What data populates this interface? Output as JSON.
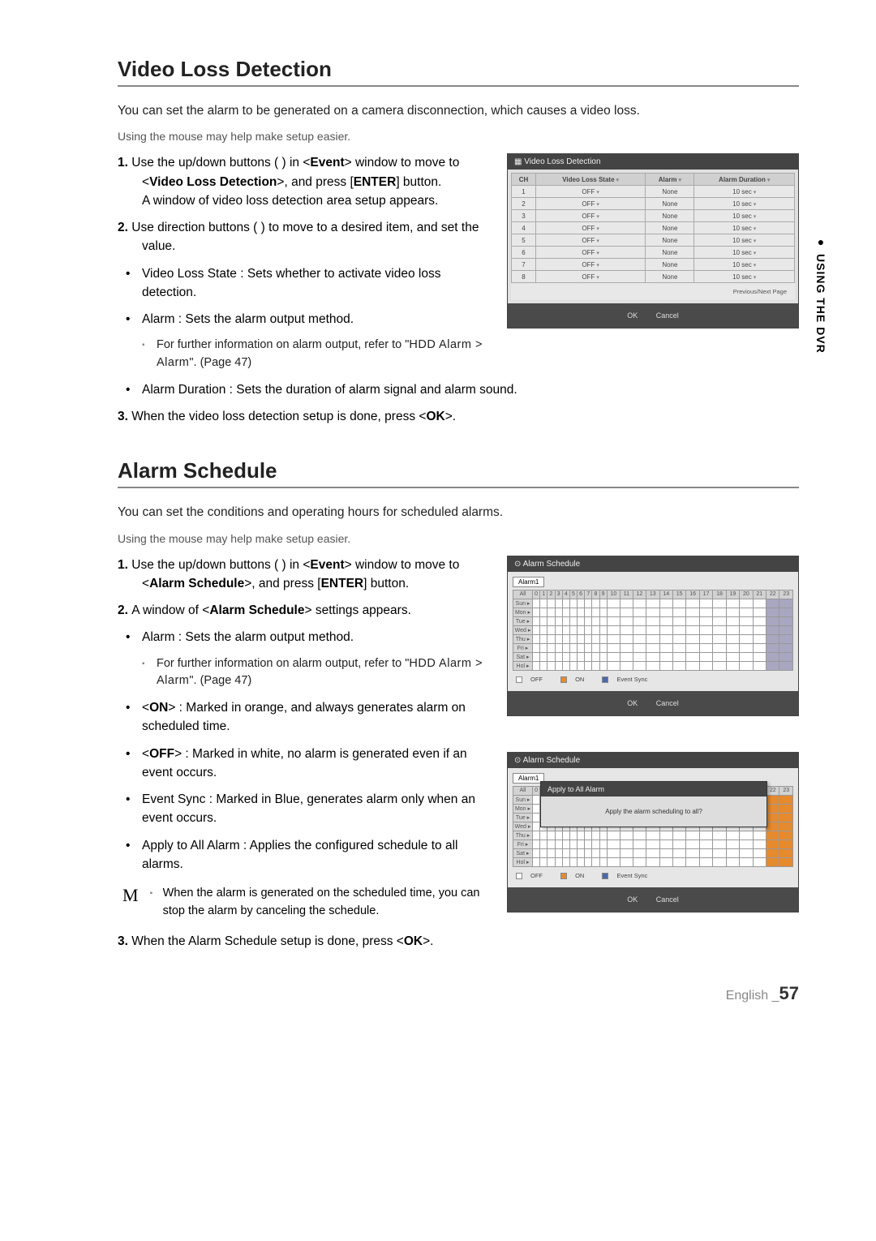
{
  "side_tab": "USING THE DVR",
  "section1": {
    "title": "Video Loss Detection",
    "intro": "You can set the alarm to be generated on a camera disconnection, which causes a video loss.",
    "mouse_hint": "Using the mouse may help make setup easier.",
    "step1_num": "1.",
    "step1_a": "Use the up/down buttons (     ) in <",
    "step1_event": "Event",
    "step1_b": "> window to move to <",
    "step1_vld": "Video Loss Detection",
    "step1_c": ">, and press [",
    "step1_enter": "ENTER",
    "step1_d": "] button.",
    "step1_e": "A window of video loss detection area setup appears.",
    "step2_num": "2.",
    "step2_a": "Use direction buttons (           ) to move to a desired item, and set the value.",
    "bul1": "Video Loss State : Sets whether to activate video loss detection.",
    "bul2": "Alarm : Sets the alarm output method.",
    "sub1_a": "For further information on alarm output, refer to \"",
    "sub1_hdd": "HDD Alarm > Alarm",
    "sub1_b": "\". (Page 47)",
    "bul3": "Alarm Duration : Sets the duration of alarm signal and alarm sound.",
    "step3_num": "3.",
    "step3_a": "When the video loss detection setup is done, press <",
    "step3_ok": "OK",
    "step3_b": ">."
  },
  "vld_panel": {
    "title": "Video Loss Detection",
    "headers": {
      "ch": "CH",
      "state": "Video Loss State",
      "alarm": "Alarm",
      "duration": "Alarm Duration"
    },
    "rows": [
      {
        "ch": "1",
        "state": "OFF",
        "alarm": "None",
        "duration": "10 sec"
      },
      {
        "ch": "2",
        "state": "OFF",
        "alarm": "None",
        "duration": "10 sec"
      },
      {
        "ch": "3",
        "state": "OFF",
        "alarm": "None",
        "duration": "10 sec"
      },
      {
        "ch": "4",
        "state": "OFF",
        "alarm": "None",
        "duration": "10 sec"
      },
      {
        "ch": "5",
        "state": "OFF",
        "alarm": "None",
        "duration": "10 sec"
      },
      {
        "ch": "6",
        "state": "OFF",
        "alarm": "None",
        "duration": "10 sec"
      },
      {
        "ch": "7",
        "state": "OFF",
        "alarm": "None",
        "duration": "10 sec"
      },
      {
        "ch": "8",
        "state": "OFF",
        "alarm": "None",
        "duration": "10 sec"
      }
    ],
    "prevnext": "Previous/Next Page",
    "ok": "OK",
    "cancel": "Cancel"
  },
  "section2": {
    "title": "Alarm Schedule",
    "intro": "You can set the conditions and operating hours for scheduled alarms.",
    "mouse_hint": "Using the mouse may help make setup easier.",
    "step1_num": "1.",
    "step1_a": "Use the up/down buttons (     ) in <",
    "step1_event": "Event",
    "step1_b": "> window to move to <",
    "step1_as": "Alarm Schedule",
    "step1_c": ">, and press [",
    "step1_enter": "ENTER",
    "step1_d": "] button.",
    "step2_num": "2.",
    "step2_a": "A window of <",
    "step2_as": "Alarm Schedule",
    "step2_b": "> settings appears.",
    "bul1": "Alarm : Sets the alarm output method.",
    "sub1_a": "For further information on alarm output, refer to \"",
    "sub1_hdd": "HDD Alarm > Alarm",
    "sub1_b": "\". (Page 47)",
    "bul2_a": "<",
    "bul2_on": "ON",
    "bul2_b": "> : Marked in orange, and always generates alarm on scheduled time.",
    "bul3_a": "<",
    "bul3_off": "OFF",
    "bul3_b": "> : Marked in white, no alarm is generated even if an event occurs.",
    "bul4": "Event Sync : Marked in Blue, generates alarm only when an event occurs.",
    "bul5": "Apply to All Alarm : Applies the configured schedule to all alarms.",
    "note": "When the alarm is generated on the scheduled time, you can stop the alarm by canceling the schedule.",
    "step3_num": "3.",
    "step3_a": "When the Alarm Schedule setup is done, press <",
    "step3_ok": "OK",
    "step3_b": ">."
  },
  "sched_panel": {
    "title": "Alarm Schedule",
    "alarm_label": "Alarm1",
    "all": "All",
    "hours": [
      "0",
      "1",
      "2",
      "3",
      "4",
      "5",
      "6",
      "7",
      "8",
      "9",
      "10",
      "11",
      "12",
      "13",
      "14",
      "15",
      "16",
      "17",
      "18",
      "19",
      "20",
      "21",
      "22",
      "23"
    ],
    "days": [
      "Sun ▸",
      "Mon ▸",
      "Tue ▸",
      "Wed ▸",
      "Thu ▸",
      "Fri ▸",
      "Sat ▸",
      "Hol ▸"
    ],
    "legend_off": "OFF",
    "legend_on": "ON",
    "legend_sync": "Event Sync",
    "ok": "OK",
    "cancel": "Cancel"
  },
  "popup": {
    "title": "Apply to All Alarm",
    "msg": "Apply the alarm scheduling to all?"
  },
  "footer": {
    "lang": "English _",
    "page": "57"
  }
}
